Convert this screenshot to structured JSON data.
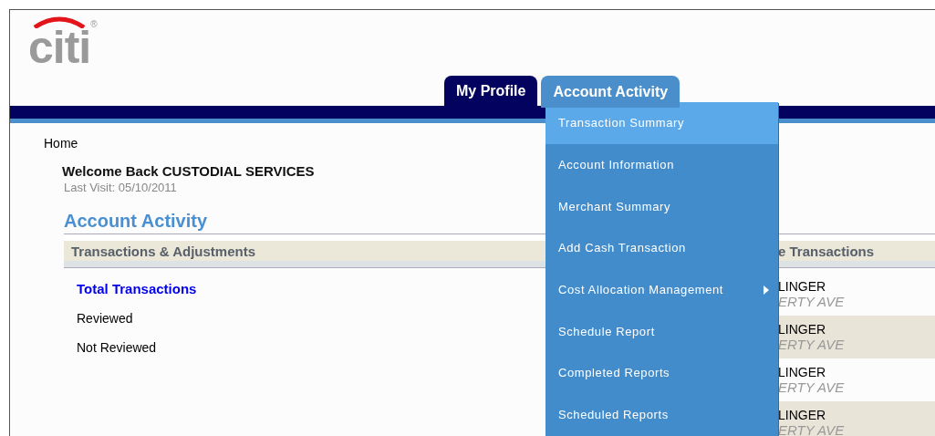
{
  "logo": {
    "text": "citi",
    "mark": "®"
  },
  "tabs": [
    {
      "label": "My Profile",
      "selected": false
    },
    {
      "label": "Account Activity",
      "selected": true
    }
  ],
  "menu": {
    "items": [
      {
        "label": "Transaction Summary",
        "selected": true,
        "has_submenu": false
      },
      {
        "label": "Account Information",
        "selected": false,
        "has_submenu": false
      },
      {
        "label": "Merchant Summary",
        "selected": false,
        "has_submenu": false
      },
      {
        "label": "Add Cash Transaction",
        "selected": false,
        "has_submenu": false
      },
      {
        "label": "Cost Allocation Management",
        "selected": false,
        "has_submenu": true
      },
      {
        "label": "Schedule Report",
        "selected": false,
        "has_submenu": false
      },
      {
        "label": "Completed Reports",
        "selected": false,
        "has_submenu": false
      },
      {
        "label": "Scheduled Reports",
        "selected": false,
        "has_submenu": false
      }
    ]
  },
  "breadcrumb": "Home",
  "welcome": "Welcome Back CUSTODIAL SERVICES",
  "last_visit": "Last Visit: 05/10/2011",
  "heading": "Account Activity",
  "section": {
    "title": "Transactions & Adjustments",
    "items": [
      {
        "label": "Total Transactions",
        "kind": "link"
      },
      {
        "label": "Reviewed",
        "kind": "text"
      },
      {
        "label": "Not Reviewed",
        "kind": "text"
      }
    ]
  },
  "side": {
    "title": "e Transactions",
    "rows": [
      {
        "name": "LINGER",
        "address": "ERTY AVE"
      },
      {
        "name": "LINGER",
        "address": "ERTY AVE"
      },
      {
        "name": "LINGER",
        "address": "ERTY AVE"
      },
      {
        "name": "LINGER",
        "address": "ERTY AVE"
      }
    ]
  }
}
